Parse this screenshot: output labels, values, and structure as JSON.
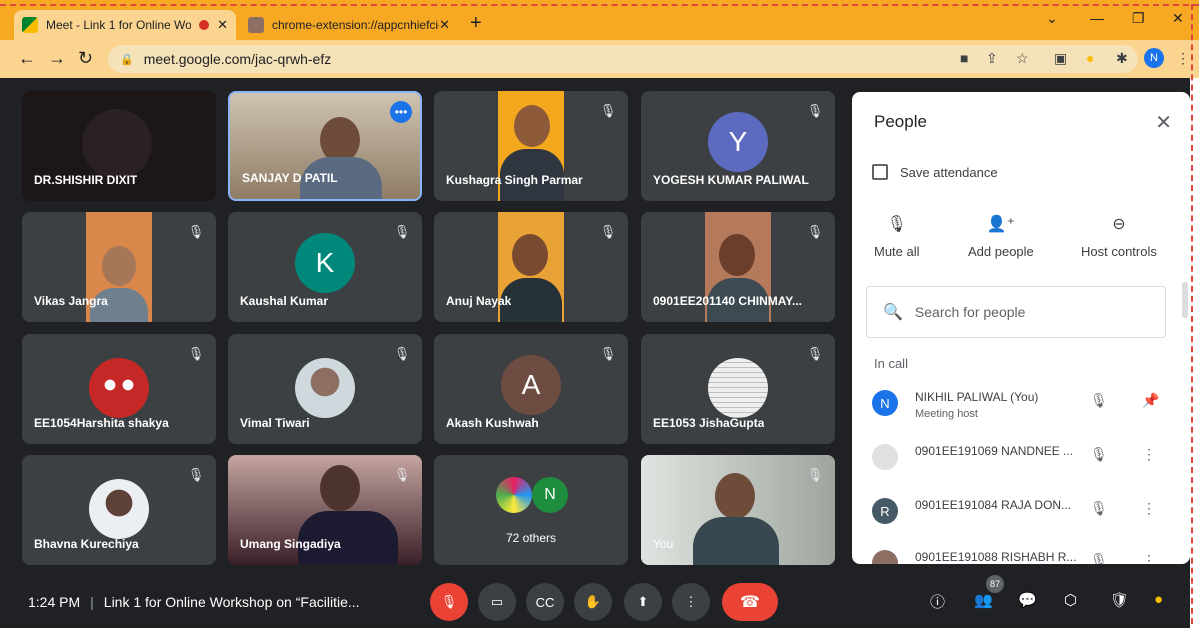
{
  "browser": {
    "tabs": [
      {
        "title": "Meet - Link 1 for Online Wor",
        "active": true
      },
      {
        "title": "chrome-extension://appcnhiefcic",
        "active": false
      }
    ],
    "url": "meet.google.com/jac-qrwh-efz",
    "profile_initial": "N",
    "colors": {
      "tabbar": "#f7a923",
      "toolbar": "#fbd48f"
    }
  },
  "tiles": [
    {
      "name": "DR.SHISHIR DIXIT"
    },
    {
      "name": "SANJAY D PATIL"
    },
    {
      "name": "Kushagra Singh Parmar"
    },
    {
      "name": "YOGESH KUMAR PALIWAL",
      "letter": "Y"
    },
    {
      "name": "Vikas Jangra"
    },
    {
      "name": "Kaushal Kumar",
      "letter": "K"
    },
    {
      "name": "Anuj Nayak"
    },
    {
      "name": "0901EE201140 CHINMAY..."
    },
    {
      "name": "EE1054Harshita shakya"
    },
    {
      "name": "Vimal Tiwari"
    },
    {
      "name": "Akash Kushwah",
      "letter": "A"
    },
    {
      "name": "EE1053 JishaGupta"
    },
    {
      "name": "Bhavna Kurechiya"
    },
    {
      "name": "Umang Singadiya"
    },
    {
      "name": "72 others",
      "letter": "N"
    },
    {
      "name": "You"
    }
  ],
  "panel": {
    "title": "People",
    "save_attendance": "Save attendance",
    "actions": {
      "mute_all": "Mute all",
      "add_people": "Add people",
      "host_controls": "Host controls"
    },
    "search_placeholder": "Search for people",
    "in_call": "In call",
    "people": [
      {
        "name": "NIKHIL PALIWAL (You)",
        "role": "Meeting host",
        "initial": "N"
      },
      {
        "name": "0901EE191069 NANDNEE ..."
      },
      {
        "name": "0901EE191084 RAJA DON...",
        "initial": "R"
      },
      {
        "name": "0901EE191088 RISHABH R..."
      }
    ]
  },
  "bottom": {
    "time": "1:24 PM",
    "meeting_title": "Link 1 for Online Workshop on “Facilitie...",
    "participants_count": "87"
  }
}
